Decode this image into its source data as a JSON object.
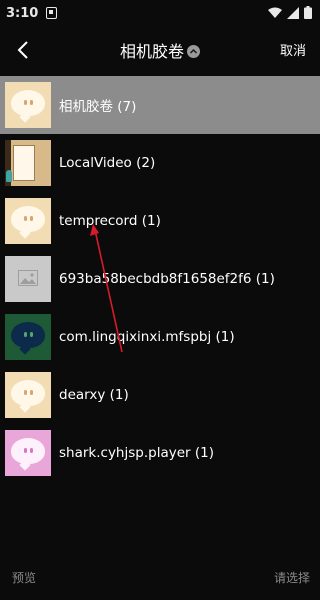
{
  "status": {
    "time": "3:10"
  },
  "header": {
    "title": "相机胶卷",
    "cancel_label": "取消"
  },
  "albums": [
    {
      "label": "相机胶卷 (7)",
      "thumb": "cream",
      "selected": true
    },
    {
      "label": "LocalVideo (2)",
      "thumb": "video",
      "selected": false
    },
    {
      "label": "temprecord (1)",
      "thumb": "cream",
      "selected": false
    },
    {
      "label": "693ba58becbdb8f1658ef2f6 (1)",
      "thumb": "gray",
      "selected": false
    },
    {
      "label": "com.lingqixinxi.mfspbj (1)",
      "thumb": "green",
      "selected": false
    },
    {
      "label": "dearxy (1)",
      "thumb": "cream",
      "selected": false
    },
    {
      "label": "shark.cyhjsp.player (1)",
      "thumb": "pink",
      "selected": false
    }
  ],
  "footer": {
    "preview_label": "预览",
    "select_label": "请选择"
  },
  "colors": {
    "selected_row": "#8c8c8c",
    "annotation_arrow": "#d81b2a"
  },
  "icons": {
    "back": "chevron-left-icon",
    "title_dropdown": "chevron-up-circle-icon",
    "placeholder": "image-placeholder-icon"
  }
}
